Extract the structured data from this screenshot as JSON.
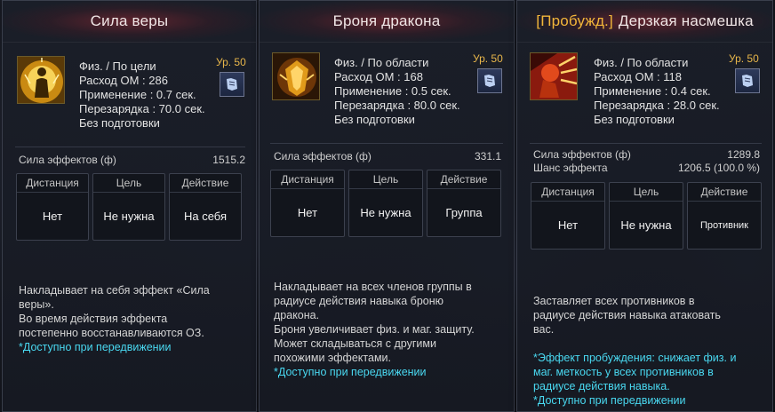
{
  "cards": [
    {
      "title": "Сила веры",
      "level": "Ур. 50",
      "info": [
        "Физ. / По цели",
        "Расход ОМ : 286",
        "Применение : 0.7 сек.",
        "Перезарядка : 70.0 сек.",
        "Без подготовки"
      ],
      "stats": [
        {
          "label": "Сила эффектов (ф)",
          "value": "1515.2"
        }
      ],
      "boxes": [
        {
          "label": "Дистанция",
          "value": "Нет"
        },
        {
          "label": "Цель",
          "value": "Не нужна"
        },
        {
          "label": "Действие",
          "value": "На себя"
        }
      ],
      "desc": [
        "Накладывает на себя эффект «Сила",
        "веры».",
        "Во время действия эффекта",
        "постепенно восстанавливаются ОЗ."
      ],
      "desc_note": [
        "*Доступно при передвижении"
      ]
    },
    {
      "title": "Броня дракона",
      "level": "Ур. 50",
      "info": [
        "Физ. / По области",
        "Расход ОМ : 168",
        "Применение : 0.5 сек.",
        "Перезарядка : 80.0 сек.",
        "Без подготовки"
      ],
      "stats": [
        {
          "label": "Сила эффектов (ф)",
          "value": "331.1"
        }
      ],
      "boxes": [
        {
          "label": "Дистанция",
          "value": "Нет"
        },
        {
          "label": "Цель",
          "value": "Не нужна"
        },
        {
          "label": "Действие",
          "value": "Группа"
        }
      ],
      "desc": [
        "Накладывает на всех членов группы в",
        "радиусе действия навыка броню",
        "дракона.",
        "Броня увеличивает физ. и маг. защиту.",
        "Может складываться с другими",
        "похожими эффектами."
      ],
      "desc_note": [
        "*Доступно при передвижении"
      ]
    },
    {
      "title_tag": "[Пробужд.]",
      "title": "Дерзкая насмешка",
      "level": "Ур. 50",
      "info": [
        "Физ. / По области",
        "Расход ОМ : 118",
        "Применение : 0.4 сек.",
        "Перезарядка : 28.0 сек.",
        "Без подготовки"
      ],
      "stats": [
        {
          "label": "Сила эффектов (ф)",
          "value": "1289.8"
        },
        {
          "label": "Шанс эффекта",
          "value": "1206.5 (100.0 %)"
        }
      ],
      "boxes": [
        {
          "label": "Дистанция",
          "value": "Нет"
        },
        {
          "label": "Цель",
          "value": "Не нужна"
        },
        {
          "label": "Действие",
          "value": "Противник"
        }
      ],
      "desc": [
        "Заставляет всех противников в",
        "радиусе действия навыка атаковать",
        "вас."
      ],
      "desc_note": [
        "*Эффект пробуждения: снижает физ. и",
        "маг. меткость у всех противников в",
        "радиусе действия навыка.",
        "*Доступно при передвижении"
      ]
    }
  ],
  "colors": {
    "accent_gold": "#e8b64a",
    "awake_tag": "#f2b63a",
    "note_cyan": "#49d8f0",
    "title_glow": "#962832"
  },
  "icons": [
    "faith-aura-icon",
    "dragon-armor-icon",
    "taunt-shout-icon",
    "skill-book-icon"
  ]
}
